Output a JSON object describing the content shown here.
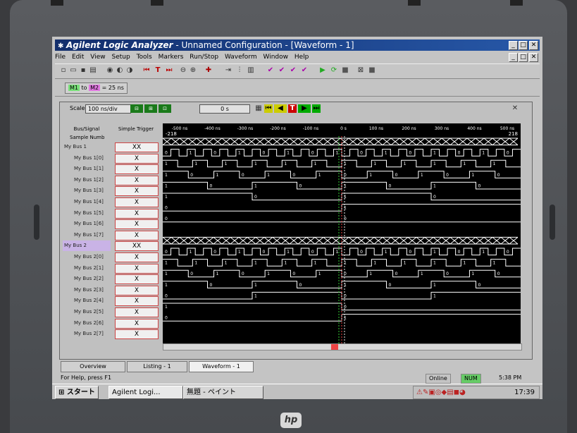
{
  "window": {
    "app": "Agilent Logic Analyzer",
    "title_rest": " - Unnamed Configuration - [Waveform - 1]"
  },
  "menu": [
    "File",
    "Edit",
    "View",
    "Setup",
    "Tools",
    "Markers",
    "Run/Stop",
    "Waveform",
    "Window",
    "Help"
  ],
  "markers": {
    "m1": "M1",
    "to": "to",
    "m2": "M2",
    "delta": "= 25 ns"
  },
  "scale": {
    "label": "Scale",
    "value": "100 ns/div",
    "offset": "0 s"
  },
  "columns": {
    "bus": "Bus/Signal",
    "trigger": "Simple Trigger"
  },
  "sample_row": {
    "label": "Sample Numb",
    "left": "-218",
    "right": "218"
  },
  "time_ticks": [
    "-500 ns",
    "-400 ns",
    "-300 ns",
    "-200 ns",
    "-100 ns",
    "0 s",
    "100 ns",
    "200 ns",
    "300 ns",
    "400 ns",
    "500 ns"
  ],
  "rows": [
    {
      "name": "My Bus 1",
      "bus": true,
      "trigger": "XX",
      "values": []
    },
    {
      "name": "My Bus 1[0]",
      "trigger": "X",
      "values": [
        "0",
        "1",
        "0",
        "1",
        "0",
        "1",
        "0",
        "1",
        "0",
        "1",
        "0",
        "1",
        "0",
        "1",
        "0",
        "1",
        "0",
        "1",
        "0",
        "1",
        "0",
        "1",
        "0",
        "1",
        "0",
        "1",
        "0",
        "1",
        "0",
        "1",
        "0",
        "1",
        "0",
        "1",
        "0",
        "1",
        "0",
        "1",
        "0",
        "1",
        "0",
        "1",
        "0",
        "1"
      ]
    },
    {
      "name": "My Bus 1[1]",
      "trigger": "X",
      "values": [
        "1",
        "0",
        "1",
        "0",
        "1",
        "0",
        "1",
        "0",
        "1",
        "0",
        "1",
        "0",
        "1",
        "0",
        "1",
        "0",
        "1",
        "0",
        "1",
        "0",
        "1",
        "0",
        "1",
        "0"
      ]
    },
    {
      "name": "My Bus 1[2]",
      "trigger": "X",
      "values": [
        "1",
        "0",
        "1",
        "0",
        "1",
        "0",
        "1",
        "0",
        "1",
        "0",
        "1",
        "0",
        "1",
        "0"
      ]
    },
    {
      "name": "My Bus 1[3]",
      "trigger": "X",
      "values": [
        "1",
        "0",
        "1",
        "0",
        "1",
        "0",
        "1",
        "0"
      ]
    },
    {
      "name": "My Bus 1[4]",
      "trigger": "X",
      "values": [
        "1",
        "0",
        "1",
        "0"
      ]
    },
    {
      "name": "My Bus 1[5]",
      "trigger": "X",
      "values": [
        "0",
        "1"
      ]
    },
    {
      "name": "My Bus 1[6]",
      "trigger": "X",
      "values": [
        "0",
        "0"
      ]
    },
    {
      "name": "My Bus 1[7]",
      "trigger": "X",
      "values": []
    },
    {
      "name": "My Bus 2",
      "bus": true,
      "trigger": "XX",
      "values": []
    },
    {
      "name": "My Bus 2[0]",
      "trigger": "X",
      "values": [
        "0",
        "1",
        "0",
        "1",
        "0",
        "1",
        "0",
        "1",
        "0",
        "1",
        "0",
        "1",
        "0",
        "1",
        "0",
        "1",
        "0",
        "1",
        "0",
        "1",
        "0",
        "1",
        "0",
        "1",
        "0",
        "1",
        "0",
        "1",
        "0",
        "1",
        "0",
        "1",
        "0",
        "1",
        "0",
        "1",
        "0",
        "1",
        "0",
        "1",
        "0",
        "1",
        "0",
        "1"
      ]
    },
    {
      "name": "My Bus 2[1]",
      "trigger": "X",
      "values": [
        "1",
        "0",
        "1",
        "0",
        "1",
        "0",
        "1",
        "0",
        "1",
        "0",
        "1",
        "0",
        "1",
        "0",
        "1",
        "0",
        "1",
        "0",
        "1",
        "0",
        "1",
        "0",
        "1",
        "0"
      ]
    },
    {
      "name": "My Bus 2[2]",
      "trigger": "X",
      "values": [
        "1",
        "0",
        "1",
        "0",
        "1",
        "0",
        "1",
        "0",
        "1",
        "0",
        "1",
        "0",
        "1",
        "0"
      ]
    },
    {
      "name": "My Bus 2[3]",
      "trigger": "X",
      "values": [
        "1",
        "0",
        "1",
        "0",
        "1",
        "0",
        "1",
        "0"
      ]
    },
    {
      "name": "My Bus 2[4]",
      "trigger": "X",
      "values": [
        "0",
        "1",
        "0",
        "1"
      ]
    },
    {
      "name": "My Bus 2[5]",
      "trigger": "X",
      "values": [
        "1",
        "0"
      ]
    },
    {
      "name": "My Bus 2[6]",
      "trigger": "X",
      "values": [
        "0",
        "1"
      ]
    },
    {
      "name": "My Bus 2[7]",
      "trigger": "X",
      "values": []
    }
  ],
  "tabs": [
    "Overview",
    "Listing - 1",
    "Waveform - 1"
  ],
  "status": {
    "help": "For Help, press F1",
    "online": "Online",
    "num": "NUM",
    "time": "5:38 PM"
  },
  "taskbar": {
    "start": "スタート",
    "task1": "Agilent Logi...",
    "task2": "無題 - ペイント",
    "clock": "17:39"
  },
  "brand": "hp"
}
